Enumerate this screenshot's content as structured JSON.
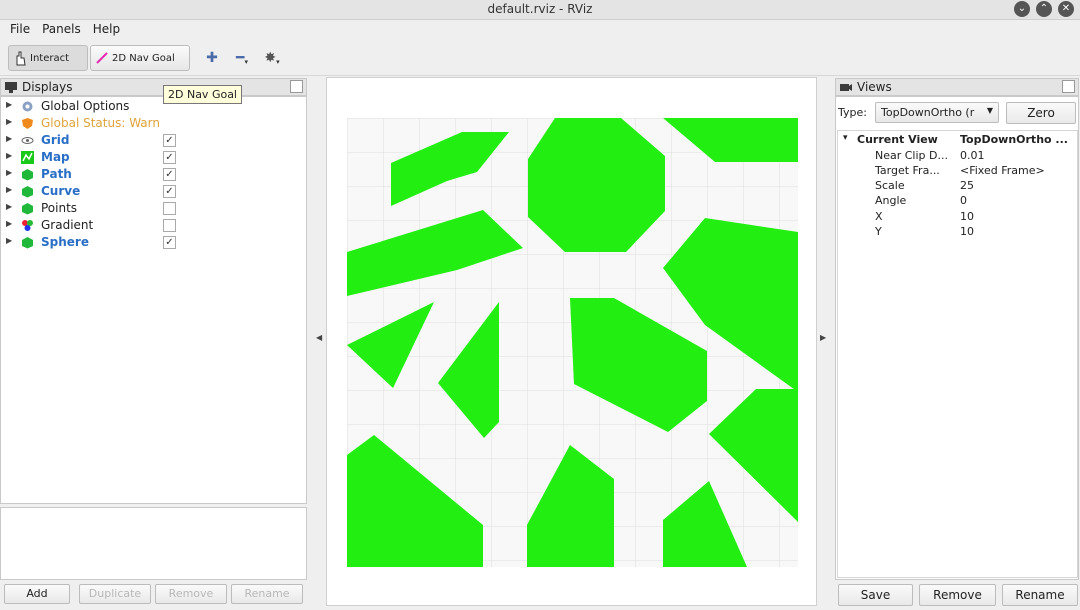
{
  "window": {
    "title": "default.rviz - RViz",
    "buttons": [
      "⌄",
      "⌃",
      "✕"
    ]
  },
  "menu": {
    "file": "File",
    "panels": "Panels",
    "help": "Help"
  },
  "toolbar": {
    "interact_label": "Interact",
    "nav_goal_label": "2D Nav Goal",
    "tooltip": "2D Nav Goal"
  },
  "displays": {
    "header": "Displays",
    "items": [
      {
        "label": "Global Options",
        "style": "normal",
        "checked": null
      },
      {
        "label": "Global Status: Warn",
        "style": "warn",
        "checked": null
      },
      {
        "label": "Grid",
        "style": "bold",
        "checked": true
      },
      {
        "label": "Map",
        "style": "bold",
        "checked": true
      },
      {
        "label": "Path",
        "style": "bold",
        "checked": true
      },
      {
        "label": "Curve",
        "style": "bold",
        "checked": true
      },
      {
        "label": "Points",
        "style": "normal",
        "checked": false
      },
      {
        "label": "Gradient",
        "style": "normal",
        "checked": false
      },
      {
        "label": "Sphere",
        "style": "bold",
        "checked": true
      }
    ],
    "buttons": {
      "add": "Add",
      "duplicate": "Duplicate",
      "remove": "Remove",
      "rename": "Rename"
    }
  },
  "views": {
    "header": "Views",
    "type_label": "Type:",
    "type_value": "TopDownOrtho (r",
    "zero": "Zero",
    "current_view_label": "Current View",
    "current_view_value": "TopDownOrtho ...",
    "props": [
      {
        "key": "Near Clip D...",
        "value": "0.01"
      },
      {
        "key": "Target Fra...",
        "value": "<Fixed Frame>"
      },
      {
        "key": "Scale",
        "value": "25"
      },
      {
        "key": "Angle",
        "value": "0"
      },
      {
        "key": "X",
        "value": "10"
      },
      {
        "key": "Y",
        "value": "10"
      }
    ],
    "buttons": {
      "save": "Save",
      "remove": "Remove",
      "rename": "Rename"
    }
  },
  "colors": {
    "obstacle": "#22ee11",
    "free": "#f7f7f7",
    "grid": "#dcdcdc",
    "accent": "#2a6fc7"
  }
}
